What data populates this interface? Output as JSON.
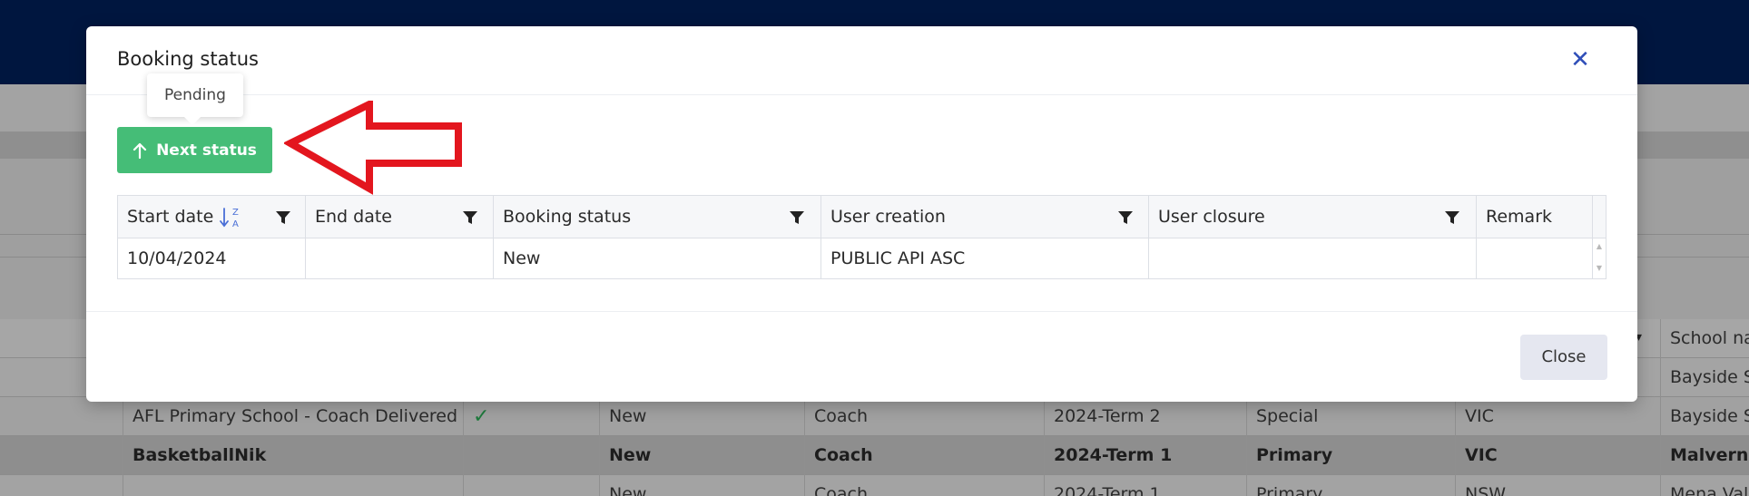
{
  "modal": {
    "title": "Booking status",
    "close_icon": "close-icon",
    "tooltip": "Pending",
    "next_status_label": "Next status",
    "close_button_label": "Close"
  },
  "status_grid": {
    "columns": [
      "Start date",
      "End date",
      "Booking status",
      "User creation",
      "User closure",
      "Remark"
    ],
    "rows": [
      {
        "start_date": "10/04/2024",
        "end_date": "",
        "booking_status": "New",
        "user_creation": "PUBLIC API ASC",
        "user_closure": "",
        "remark": ""
      }
    ]
  },
  "background_table": {
    "header_partial": "School nam",
    "rows": [
      {
        "program": "",
        "check": "",
        "status": "",
        "type": "",
        "term": "",
        "category": "",
        "state": "",
        "school": "Bayside Sp"
      },
      {
        "program": "AFL Primary School - Coach Delivered",
        "check": "✓",
        "status": "New",
        "type": "Coach",
        "term": "2024-Term 2",
        "category": "Special",
        "state": "VIC",
        "school": "Bayside Sp"
      },
      {
        "program": "BasketballNik",
        "check": "",
        "status": "New",
        "type": "Coach",
        "term": "2024-Term 1",
        "category": "Primary",
        "state": "VIC",
        "school": "Malvern Ce"
      },
      {
        "program": "",
        "check": "",
        "status": "New",
        "type": "Coach",
        "term": "2024-Term 1",
        "category": "Primary",
        "state": "NSW",
        "school": "Mena Vale"
      }
    ]
  },
  "colors": {
    "header_navy": "#00163f",
    "next_status_green": "#45bd77",
    "annotation_red": "#e3161e",
    "close_x_blue": "#2f4eb8"
  }
}
